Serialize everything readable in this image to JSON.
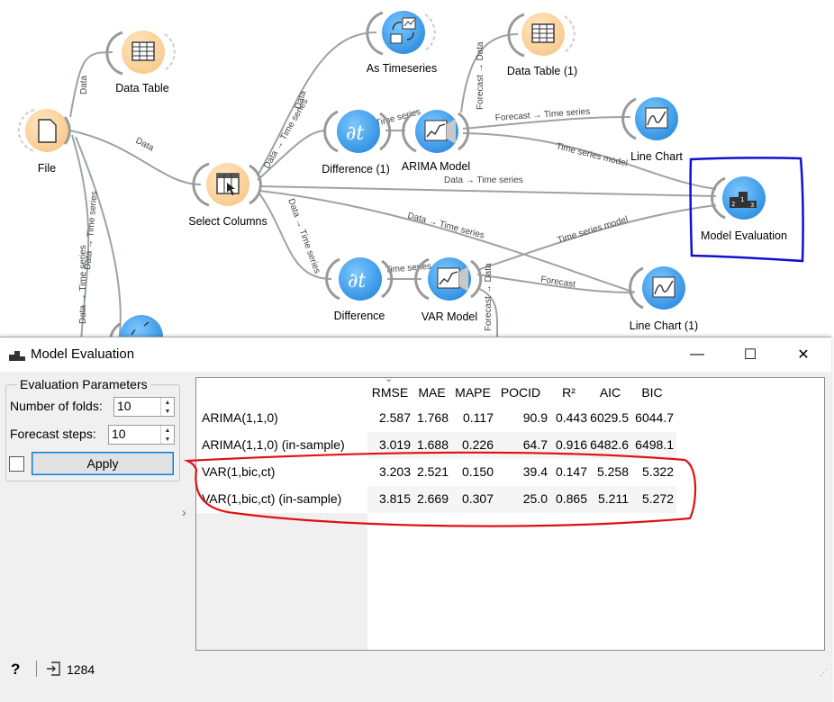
{
  "canvas": {
    "nodes": {
      "file": "File",
      "data_table": "Data Table",
      "as_timeseries": "As Timeseries",
      "data_table_1": "Data Table (1)",
      "select_columns": "Select Columns",
      "difference_1": "Difference (1)",
      "arima_model": "ARIMA Model",
      "line_chart": "Line Chart",
      "model_evaluation": "Model Evaluation",
      "difference": "Difference",
      "var_model": "VAR Model",
      "line_chart_1": "Line Chart (1)"
    },
    "links": {
      "file_datatable": "Data",
      "file_select": "Data",
      "select_astime": "Data",
      "select_diff1": "Data → Time series",
      "file_down_a": "Data → Time series",
      "file_down_b": "Data → Time series",
      "diff1_arima": "Time series",
      "arima_dt1": "Forecast → Data",
      "arima_line": "Forecast → Time series",
      "arima_eval": "Time series model",
      "select_eval": "Data → Time series",
      "select_line1": "Data → Time series",
      "select_diff": "Data → Time series",
      "diff_var": "Time series",
      "var_eval": "Time series model",
      "var_line1": "Forecast",
      "var_down": "Forecast → Data"
    }
  },
  "window": {
    "title": "Model Evaluation",
    "buttons": {
      "minimize": "—",
      "maximize": "☐",
      "close": "✕"
    },
    "params": {
      "group_title": "Evaluation Parameters",
      "folds_label": "Number of folds:",
      "folds_value": "10",
      "steps_label": "Forecast steps:",
      "steps_value": "10",
      "apply_label": "Apply",
      "checkbox_checked": false
    },
    "table": {
      "columns": [
        "RMSE",
        "MAE",
        "MAPE",
        "POCID",
        "R²",
        "AIC",
        "BIC"
      ],
      "rows": [
        {
          "name": "ARIMA(1,1,0)",
          "values": [
            "2.587",
            "1.768",
            "0.117",
            "90.9",
            "0.443",
            "6029.5",
            "6044.7"
          ]
        },
        {
          "name": "ARIMA(1,1,0) (in-sample)",
          "values": [
            "3.019",
            "1.688",
            "0.226",
            "64.7",
            "0.916",
            "6482.6",
            "6498.1"
          ]
        },
        {
          "name": "VAR(1,bic,ct)",
          "values": [
            "3.203",
            "2.521",
            "0.150",
            "39.4",
            "0.147",
            "5.258",
            "5.322"
          ]
        },
        {
          "name": "VAR(1,bic,ct) (in-sample)",
          "values": [
            "3.815",
            "2.669",
            "0.307",
            "25.0",
            "0.865",
            "5.211",
            "5.272"
          ]
        }
      ]
    },
    "status": {
      "help_icon": "?",
      "input_count": "1284"
    }
  },
  "colors": {
    "node_orange": "#fcd9a8",
    "node_blue": "#4aa8f0",
    "link": "#9aa3a8",
    "annotation_blue": "#1010d0",
    "annotation_red": "#e01010"
  }
}
